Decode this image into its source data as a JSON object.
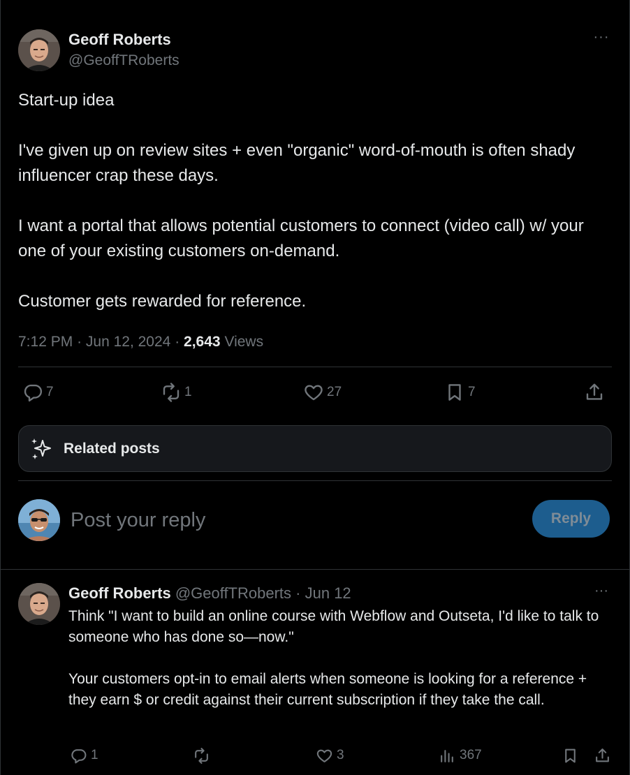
{
  "main_post": {
    "author_name": "Geoff Roberts",
    "author_handle": "@GeoffTRoberts",
    "more_label": "···",
    "paragraphs": [
      "Start-up idea",
      "I've given up on review sites + even \"organic\" word-of-mouth is often shady influencer crap these days.",
      "I want a portal that allows potential customers to connect (video call) w/ your one of your existing customers on-demand.",
      "Customer gets rewarded for reference."
    ],
    "time": "7:12 PM",
    "date": "Jun 12, 2024",
    "views_count": "2,643",
    "views_label": "Views",
    "separator": "·",
    "stats": {
      "replies": "7",
      "reposts": "1",
      "likes": "27",
      "bookmarks": "7"
    }
  },
  "related_posts": {
    "label": "Related posts"
  },
  "reply_box": {
    "placeholder": "Post your reply",
    "button_label": "Reply"
  },
  "reply_post": {
    "author_name": "Geoff Roberts",
    "author_handle": "@GeoffTRoberts",
    "separator": "·",
    "date": "Jun 12",
    "more_label": "···",
    "paragraphs": [
      "Think \"I want to build an online course with Webflow and Outseta, I'd like to talk to someone who has done so—now.\"",
      "Your customers opt-in to email alerts when someone is looking for a reference + they earn $ or credit against their current subscription if they take the call."
    ],
    "stats": {
      "replies": "1",
      "reposts": "",
      "likes": "3",
      "views": "367"
    }
  },
  "colors": {
    "background": "#000000",
    "text_primary": "#e7e9ea",
    "text_secondary": "#71767b",
    "border": "#2f3336",
    "reply_button": "#1d5d8e"
  },
  "icons": [
    "reply-icon",
    "repost-icon",
    "like-icon",
    "bookmark-icon",
    "share-icon",
    "sparkle-icon",
    "views-icon",
    "more-icon"
  ]
}
